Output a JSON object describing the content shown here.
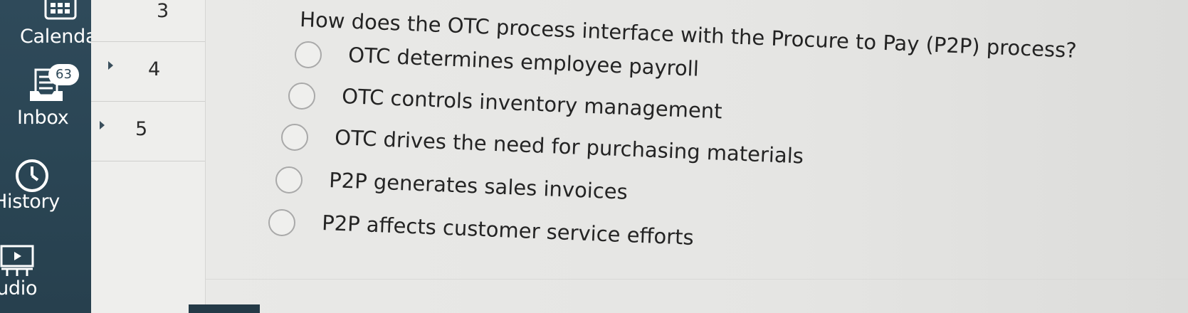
{
  "nav": {
    "calendar_label": "Calendar",
    "inbox_label": "Inbox",
    "inbox_badge": "63",
    "history_label": "History",
    "studio_label": "Studio"
  },
  "modules": {
    "rows": [
      "3",
      "4",
      "5"
    ]
  },
  "question": {
    "text": "How does the OTC process interface with the Procure to Pay (P2P) process?",
    "answers": [
      "OTC determines employee payroll",
      "OTC controls inventory management",
      "OTC drives the need for purchasing materials",
      "P2P generates sales invoices",
      "P2P affects customer service efforts"
    ]
  },
  "colors": {
    "nav_bg": "#2f4a5a",
    "page_bg": "#e4e4e2",
    "radio_border": "#a9a9a9"
  }
}
